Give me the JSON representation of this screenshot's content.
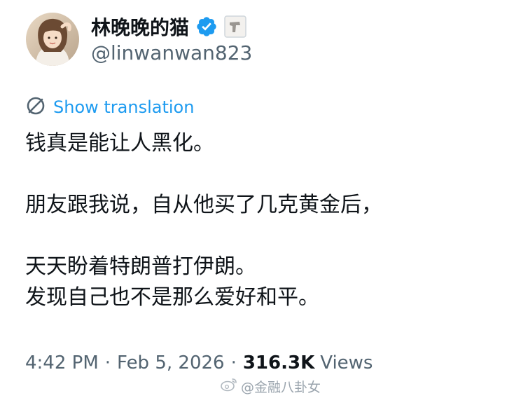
{
  "author": {
    "display_name": "林晚晚的猫",
    "handle": "@linwanwan823"
  },
  "translate_label": "Show translation",
  "tweet": {
    "lines": [
      "钱真是能让人黑化。",
      "朋友跟我说，自从他买了几克黄金后，",
      "天天盼着特朗普打伊朗。",
      "发现自己也不是那么爱好和平。"
    ]
  },
  "meta": {
    "time": "4:42 PM",
    "separator": "·",
    "date": "Feb 5, 2026",
    "views_count": "316.3K",
    "views_label": "Views"
  },
  "watermark": {
    "text": "@金融八卦女"
  },
  "icons": {
    "verified": "verified-badge-icon",
    "affiliate": "affiliate-badge-icon",
    "translate": "globe-translate-icon",
    "watermark": "weibo-logo-icon"
  },
  "colors": {
    "accent": "#1d9bf0",
    "text": "#0f1419",
    "secondary": "#536471"
  }
}
